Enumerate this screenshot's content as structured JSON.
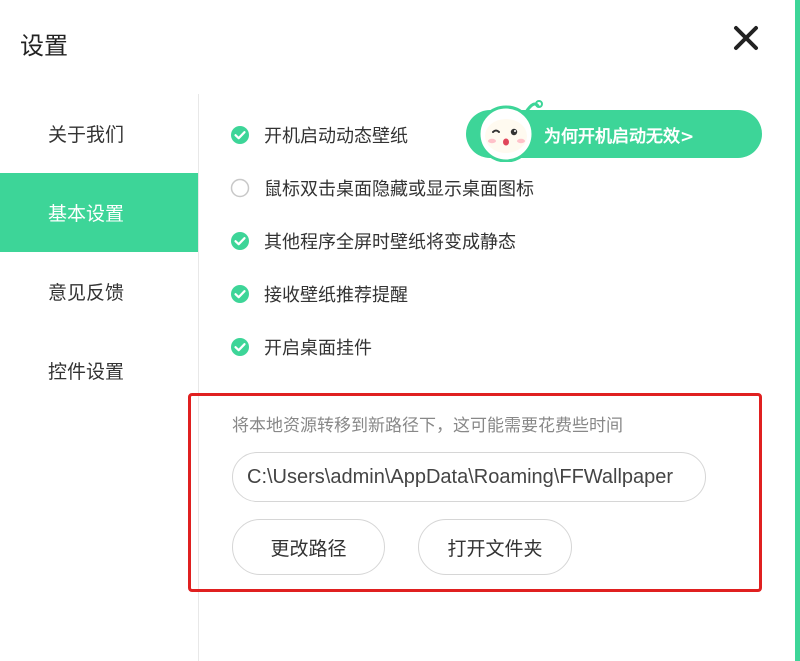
{
  "window": {
    "title": "设置",
    "accent_color": "#3dd598"
  },
  "sidebar": {
    "items": [
      {
        "label": "关于我们",
        "active": false
      },
      {
        "label": "基本设置",
        "active": true
      },
      {
        "label": "意见反馈",
        "active": false
      },
      {
        "label": "控件设置",
        "active": false
      }
    ]
  },
  "options": [
    {
      "label": "开机启动动态壁纸",
      "checked": true
    },
    {
      "label": "鼠标双击桌面隐藏或显示桌面图标",
      "checked": false
    },
    {
      "label": "其他程序全屏时壁纸将变成静态",
      "checked": true
    },
    {
      "label": "接收壁纸推荐提醒",
      "checked": true
    },
    {
      "label": "开启桌面挂件",
      "checked": true
    }
  ],
  "help_pill": {
    "label": "为何开机启动无效>"
  },
  "path_section": {
    "hint": "将本地资源转移到新路径下，这可能需要花费些时间",
    "path_value": "C:\\Users\\admin\\AppData\\Roaming\\FFWallpaper",
    "change_button": "更改路径",
    "open_button": "打开文件夹"
  },
  "icons": {
    "close": "close-icon",
    "check": "check-circle-icon",
    "unchecked": "empty-circle-icon",
    "mascot": "mascot-icon"
  }
}
